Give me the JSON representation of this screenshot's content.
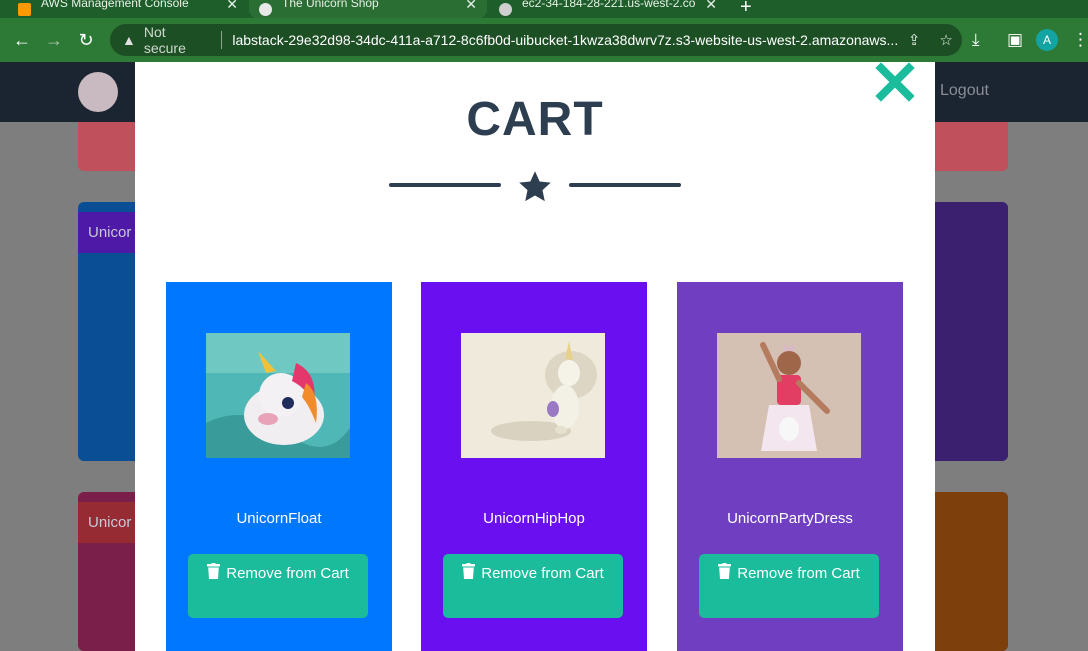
{
  "browser": {
    "tabs": [
      {
        "title": "AWS Management Console",
        "favicon": "aws-cube-icon",
        "favicon_color": "#ff9900"
      },
      {
        "title": "The Unicorn Shop",
        "favicon": "unicorn-icon",
        "favicon_color": "#ffffff"
      },
      {
        "title": "ec2-34-184-28-221.us-west-2.co",
        "favicon": "globe-icon",
        "favicon_color": "#cfcfcf"
      }
    ],
    "new_tab": "+",
    "security_label": "Not secure",
    "url": "labstack-29e32d98-34dc-411a-a712-8c6fb0d-uibucket-1kwza38dwrv7z.s3-website-us-west-2.amazonaws....",
    "profile_initial": "A"
  },
  "shop": {
    "logout_label": "Logout",
    "bg_card_label": "Unicor"
  },
  "cart": {
    "title": "CART",
    "items": [
      {
        "name": "UnicornFloat",
        "button_label": "Remove from Cart",
        "card_color": "#0077ff"
      },
      {
        "name": "UnicornHipHop",
        "button_label": "Remove from Cart",
        "card_color": "#6a0ff0"
      },
      {
        "name": "UnicornPartyDress",
        "button_label": "Remove from Cart",
        "card_color": "#6f3ec1"
      }
    ]
  },
  "colors": {
    "accent": "#1abc9c",
    "heading": "#2c3e50"
  }
}
